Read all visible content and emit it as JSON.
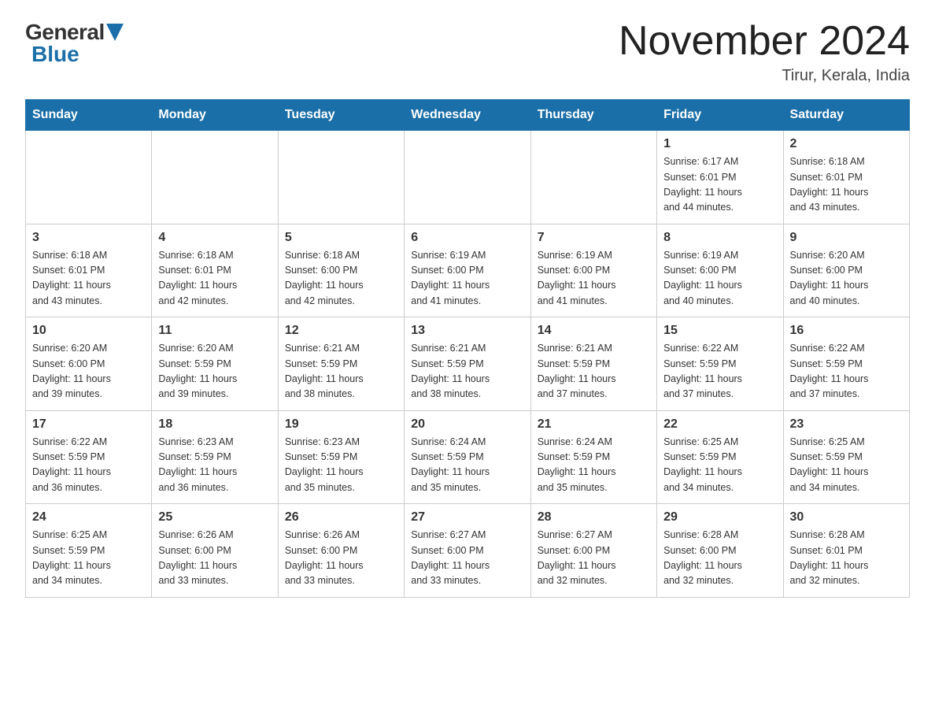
{
  "header": {
    "logo_general": "General",
    "logo_blue": "Blue",
    "title": "November 2024",
    "location": "Tirur, Kerala, India"
  },
  "days_of_week": [
    "Sunday",
    "Monday",
    "Tuesday",
    "Wednesday",
    "Thursday",
    "Friday",
    "Saturday"
  ],
  "weeks": [
    [
      {
        "day": "",
        "info": ""
      },
      {
        "day": "",
        "info": ""
      },
      {
        "day": "",
        "info": ""
      },
      {
        "day": "",
        "info": ""
      },
      {
        "day": "",
        "info": ""
      },
      {
        "day": "1",
        "info": "Sunrise: 6:17 AM\nSunset: 6:01 PM\nDaylight: 11 hours\nand 44 minutes."
      },
      {
        "day": "2",
        "info": "Sunrise: 6:18 AM\nSunset: 6:01 PM\nDaylight: 11 hours\nand 43 minutes."
      }
    ],
    [
      {
        "day": "3",
        "info": "Sunrise: 6:18 AM\nSunset: 6:01 PM\nDaylight: 11 hours\nand 43 minutes."
      },
      {
        "day": "4",
        "info": "Sunrise: 6:18 AM\nSunset: 6:01 PM\nDaylight: 11 hours\nand 42 minutes."
      },
      {
        "day": "5",
        "info": "Sunrise: 6:18 AM\nSunset: 6:00 PM\nDaylight: 11 hours\nand 42 minutes."
      },
      {
        "day": "6",
        "info": "Sunrise: 6:19 AM\nSunset: 6:00 PM\nDaylight: 11 hours\nand 41 minutes."
      },
      {
        "day": "7",
        "info": "Sunrise: 6:19 AM\nSunset: 6:00 PM\nDaylight: 11 hours\nand 41 minutes."
      },
      {
        "day": "8",
        "info": "Sunrise: 6:19 AM\nSunset: 6:00 PM\nDaylight: 11 hours\nand 40 minutes."
      },
      {
        "day": "9",
        "info": "Sunrise: 6:20 AM\nSunset: 6:00 PM\nDaylight: 11 hours\nand 40 minutes."
      }
    ],
    [
      {
        "day": "10",
        "info": "Sunrise: 6:20 AM\nSunset: 6:00 PM\nDaylight: 11 hours\nand 39 minutes."
      },
      {
        "day": "11",
        "info": "Sunrise: 6:20 AM\nSunset: 5:59 PM\nDaylight: 11 hours\nand 39 minutes."
      },
      {
        "day": "12",
        "info": "Sunrise: 6:21 AM\nSunset: 5:59 PM\nDaylight: 11 hours\nand 38 minutes."
      },
      {
        "day": "13",
        "info": "Sunrise: 6:21 AM\nSunset: 5:59 PM\nDaylight: 11 hours\nand 38 minutes."
      },
      {
        "day": "14",
        "info": "Sunrise: 6:21 AM\nSunset: 5:59 PM\nDaylight: 11 hours\nand 37 minutes."
      },
      {
        "day": "15",
        "info": "Sunrise: 6:22 AM\nSunset: 5:59 PM\nDaylight: 11 hours\nand 37 minutes."
      },
      {
        "day": "16",
        "info": "Sunrise: 6:22 AM\nSunset: 5:59 PM\nDaylight: 11 hours\nand 37 minutes."
      }
    ],
    [
      {
        "day": "17",
        "info": "Sunrise: 6:22 AM\nSunset: 5:59 PM\nDaylight: 11 hours\nand 36 minutes."
      },
      {
        "day": "18",
        "info": "Sunrise: 6:23 AM\nSunset: 5:59 PM\nDaylight: 11 hours\nand 36 minutes."
      },
      {
        "day": "19",
        "info": "Sunrise: 6:23 AM\nSunset: 5:59 PM\nDaylight: 11 hours\nand 35 minutes."
      },
      {
        "day": "20",
        "info": "Sunrise: 6:24 AM\nSunset: 5:59 PM\nDaylight: 11 hours\nand 35 minutes."
      },
      {
        "day": "21",
        "info": "Sunrise: 6:24 AM\nSunset: 5:59 PM\nDaylight: 11 hours\nand 35 minutes."
      },
      {
        "day": "22",
        "info": "Sunrise: 6:25 AM\nSunset: 5:59 PM\nDaylight: 11 hours\nand 34 minutes."
      },
      {
        "day": "23",
        "info": "Sunrise: 6:25 AM\nSunset: 5:59 PM\nDaylight: 11 hours\nand 34 minutes."
      }
    ],
    [
      {
        "day": "24",
        "info": "Sunrise: 6:25 AM\nSunset: 5:59 PM\nDaylight: 11 hours\nand 34 minutes."
      },
      {
        "day": "25",
        "info": "Sunrise: 6:26 AM\nSunset: 6:00 PM\nDaylight: 11 hours\nand 33 minutes."
      },
      {
        "day": "26",
        "info": "Sunrise: 6:26 AM\nSunset: 6:00 PM\nDaylight: 11 hours\nand 33 minutes."
      },
      {
        "day": "27",
        "info": "Sunrise: 6:27 AM\nSunset: 6:00 PM\nDaylight: 11 hours\nand 33 minutes."
      },
      {
        "day": "28",
        "info": "Sunrise: 6:27 AM\nSunset: 6:00 PM\nDaylight: 11 hours\nand 32 minutes."
      },
      {
        "day": "29",
        "info": "Sunrise: 6:28 AM\nSunset: 6:00 PM\nDaylight: 11 hours\nand 32 minutes."
      },
      {
        "day": "30",
        "info": "Sunrise: 6:28 AM\nSunset: 6:01 PM\nDaylight: 11 hours\nand 32 minutes."
      }
    ]
  ]
}
